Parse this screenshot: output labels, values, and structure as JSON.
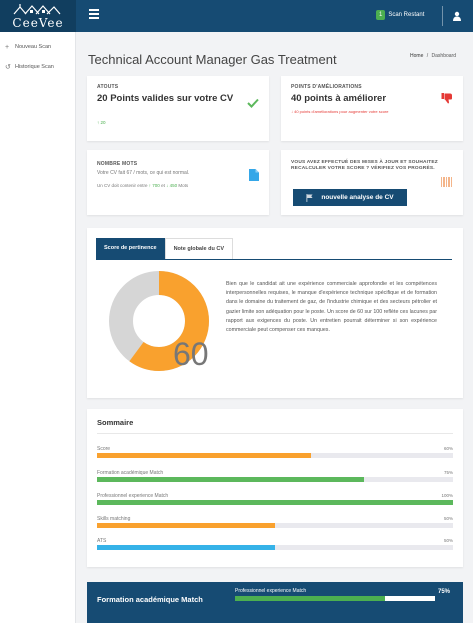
{
  "app": {
    "logo_text": "CeeVee",
    "scan_count": "1",
    "scan_label": "Scan Restant"
  },
  "sidebar": {
    "items": [
      {
        "icon": "plus-icon",
        "label": "Nouveau Scan"
      },
      {
        "icon": "history-icon",
        "label": "Historique Scan"
      }
    ]
  },
  "page": {
    "title": "Technical Account Manager Gas Treatment",
    "breadcrumb": {
      "home": "Home",
      "sep": "/",
      "current": "Dashboard"
    }
  },
  "cards": {
    "atouts": {
      "label": "ATOUTS",
      "value": "20 Points valides sur votre CV",
      "note": "↑ 20",
      "icon": "check-icon"
    },
    "ameliorations": {
      "label": "POINTS D'AMÉLIORATIONS",
      "value": "40 points à améliorer",
      "note": "↓ 40 points d'améliorations pour augmenter votre score",
      "icon": "thumbs-down-icon"
    },
    "mots": {
      "label": "NOMBRE MOTS",
      "text": "Votre CV fait 67 / mots, ce qui est normal.",
      "range_prefix": "Un CV doit contenir entre",
      "min": "↑ 700",
      "and": "et",
      "max": "↓ 450",
      "unit": "Mots",
      "icon": "document-icon"
    },
    "update": {
      "label": "VOUS AVEZ EFFECTUÉ DES MISES À JOUR ET SOUHAITEZ RECALCULER VOTRE SCORE ? VÉRIFIEZ VOS PROGRÈS.",
      "button": "nouvelle analyse de CV",
      "icon": "barcode-icon"
    }
  },
  "score_panel": {
    "tabs": [
      {
        "label": "Score de pertinence",
        "active": true
      },
      {
        "label": "Note globale du CV",
        "active": false
      }
    ],
    "score": "60",
    "score_fraction": 0.6,
    "colors": {
      "fill": "#f9a12e",
      "rest": "#d6d6d6"
    },
    "paragraph": "Bien que le candidat ait une expérience commerciale approfondie et les compétences interpersonnelles requises, le manque d'expérience technique spécifique et de formation dans le domaine du traitement de gaz, de l'industrie chimique et des secteurs pétrolier et gazier limite son adéquation pour le poste. Un score de 60 sur 100 reflète ces lacunes par rapport aux exigences du poste. Un entretien pourrait déterminer si son expérience commerciale peut compenser ces manques."
  },
  "sommaire": {
    "title": "Sommaire",
    "bars": [
      {
        "label": "Score",
        "percent_text": "60%",
        "value": 60,
        "color": "#f9a12e"
      },
      {
        "label": "Formation académique Match",
        "percent_text": "75%",
        "value": 75,
        "color": "#5cb85c"
      },
      {
        "label": "Professionnel experience Match",
        "percent_text": "100%",
        "value": 100,
        "color": "#5cb85c"
      },
      {
        "label": "Skills matching",
        "percent_text": "50%",
        "value": 50,
        "color": "#f9a12e"
      },
      {
        "label": "ATS",
        "percent_text": "50%",
        "value": 50,
        "color": "#35b2e8"
      }
    ]
  },
  "bottom": {
    "title": "Formation académique Match",
    "sub_label": "Professionnel experience Match",
    "sub_value_text": "75%",
    "sub_value": 75
  }
}
